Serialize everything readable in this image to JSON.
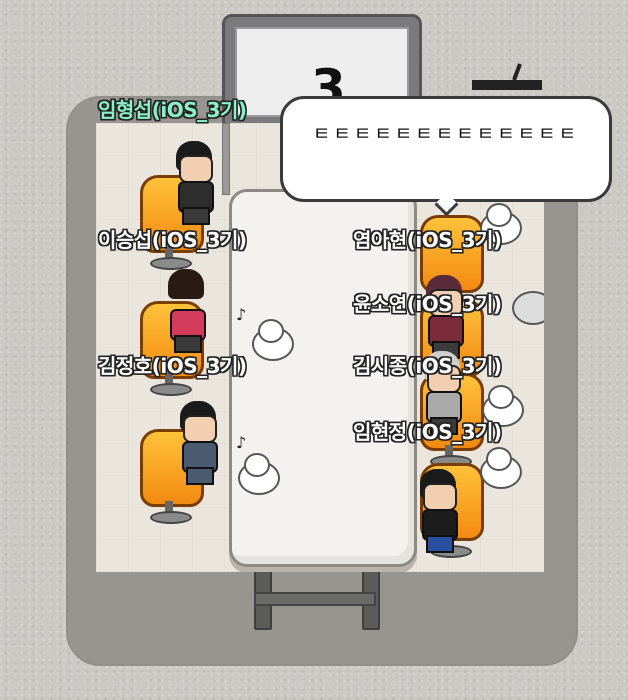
{
  "room": {
    "screen_number": "3"
  },
  "my_name": "임형섭(iOS_3기)",
  "players": [
    {
      "name": "이승섭(iOS_3기)"
    },
    {
      "name": "김정호(iOS_3기)"
    },
    {
      "name": "염아현(iOS_3기)"
    },
    {
      "name": "윤소연(iOS_3기)"
    },
    {
      "name": "김시종(iOS_3기)"
    },
    {
      "name": "임현정(iOS_3기)"
    }
  ],
  "chat_bubble": {
    "text": "ㅌㅌㅌㅌㅌㅌㅌㅌㅌㅌㅌㅌㅌ"
  },
  "colors": {
    "my_name": "#8af0cc",
    "other_names": "#ffffff",
    "chair": "#f28a12"
  },
  "icons": [
    "music-note-icon",
    "music-note-icon"
  ]
}
